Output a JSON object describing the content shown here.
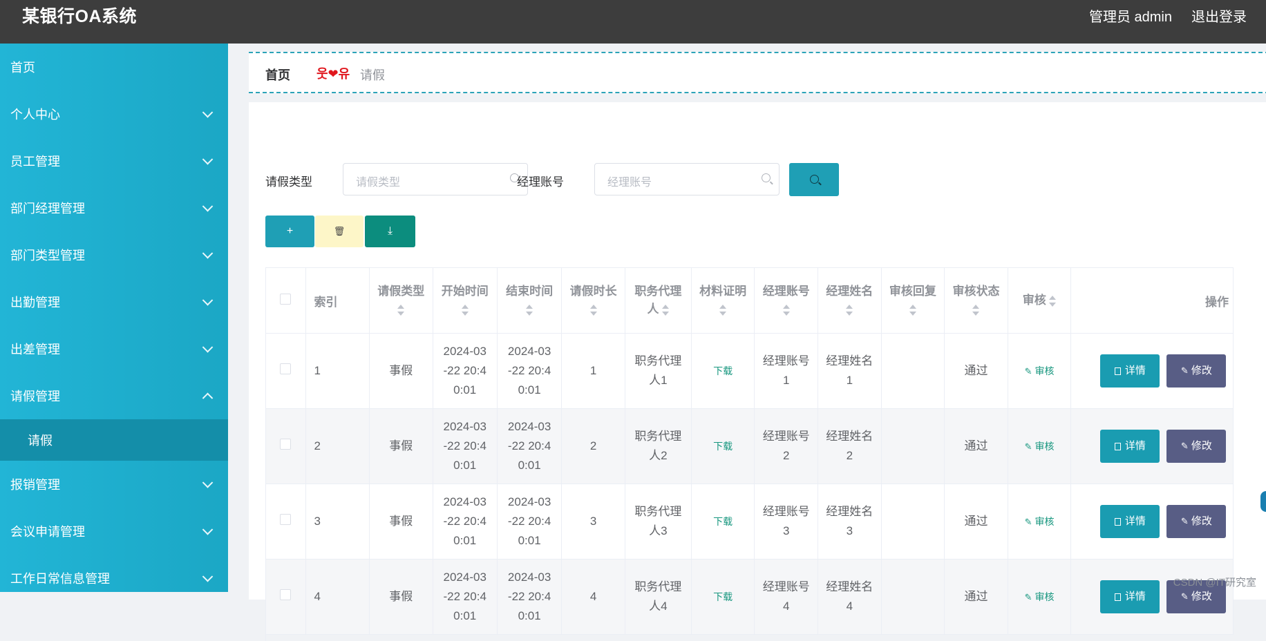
{
  "app": {
    "title": "某银行OA系统",
    "user_label": "管理员 admin",
    "logout_label": "退出登录"
  },
  "sidebar": {
    "items": [
      {
        "label": "首页"
      },
      {
        "label": "个人中心"
      },
      {
        "label": "员工管理"
      },
      {
        "label": "部门经理管理"
      },
      {
        "label": "部门类型管理"
      },
      {
        "label": "出勤管理"
      },
      {
        "label": "出差管理"
      },
      {
        "label": "请假管理"
      },
      {
        "label": "报销管理"
      },
      {
        "label": "会议申请管理"
      },
      {
        "label": "工作日常信息管理"
      }
    ],
    "submenu": {
      "label": "请假"
    }
  },
  "breadcrumb": {
    "home": "首页",
    "separator": "웃❤유",
    "current": "请假"
  },
  "search": {
    "type_label": "请假类型",
    "type_placeholder": "请假类型",
    "account_label": "经理账号",
    "account_placeholder": "经理账号"
  },
  "actions": {
    "add_icon": "+",
    "delete_icon": "🗑",
    "export_icon": "⤓"
  },
  "table": {
    "headers": {
      "index": "索引",
      "leave_type": "请假类型",
      "start_time": "开始时间",
      "end_time": "结束时间",
      "duration": "请假时长",
      "deputy": "职务代理人",
      "material": "材料证明",
      "manager_account": "经理账号",
      "manager_name": "经理姓名",
      "audit_reply": "审核回复",
      "audit_status": "审核状态",
      "audit": "审核",
      "ops": "操作"
    },
    "rows": [
      {
        "index": "1",
        "leave_type": "事假",
        "start_l1": "2024-03",
        "start_l2": "-22 20:4",
        "start_l3": "0:01",
        "end_l1": "2024-03",
        "end_l2": "-22 20:4",
        "end_l3": "0:01",
        "duration": "1",
        "deputy_l1": "职务代理",
        "deputy_l2": "人1",
        "material": "下载",
        "acct_l1": "经理账号",
        "acct_l2": "1",
        "name_l1": "经理姓名",
        "name_l2": "1",
        "reply": "",
        "status": "通过",
        "audit": "审核",
        "detail": "详情",
        "edit": "修改"
      },
      {
        "index": "2",
        "leave_type": "事假",
        "start_l1": "2024-03",
        "start_l2": "-22 20:4",
        "start_l3": "0:01",
        "end_l1": "2024-03",
        "end_l2": "-22 20:4",
        "end_l3": "0:01",
        "duration": "2",
        "deputy_l1": "职务代理",
        "deputy_l2": "人2",
        "material": "下载",
        "acct_l1": "经理账号",
        "acct_l2": "2",
        "name_l1": "经理姓名",
        "name_l2": "2",
        "reply": "",
        "status": "通过",
        "audit": "审核",
        "detail": "详情",
        "edit": "修改"
      },
      {
        "index": "3",
        "leave_type": "事假",
        "start_l1": "2024-03",
        "start_l2": "-22 20:4",
        "start_l3": "0:01",
        "end_l1": "2024-03",
        "end_l2": "-22 20:4",
        "end_l3": "0:01",
        "duration": "3",
        "deputy_l1": "职务代理",
        "deputy_l2": "人3",
        "material": "下载",
        "acct_l1": "经理账号",
        "acct_l2": "3",
        "name_l1": "经理姓名",
        "name_l2": "3",
        "reply": "",
        "status": "通过",
        "audit": "审核",
        "detail": "详情",
        "edit": "修改"
      },
      {
        "index": "4",
        "leave_type": "事假",
        "start_l1": "2024-03",
        "start_l2": "-22 20:4",
        "start_l3": "0:01",
        "end_l1": "2024-03",
        "end_l2": "-22 20:4",
        "end_l3": "0:01",
        "duration": "4",
        "deputy_l1": "职务代理",
        "deputy_l2": "人4",
        "material": "下载",
        "acct_l1": "经理账号",
        "acct_l2": "4",
        "name_l1": "经理姓名",
        "name_l2": "4",
        "reply": "",
        "status": "通过",
        "audit": "审核",
        "detail": "详情",
        "edit": "修改"
      }
    ]
  },
  "watermark": "CSDN @IT研究室",
  "colors": {
    "topbar": "#3d3d3d",
    "sidebar": "#1ba7c5",
    "submenu_active": "#148ea9",
    "primary_button": "#1f9fb5",
    "delete_button": "#fdf6c8",
    "export_button": "#0c8d7e",
    "edit_button": "#585d85",
    "link": "#16967e"
  }
}
